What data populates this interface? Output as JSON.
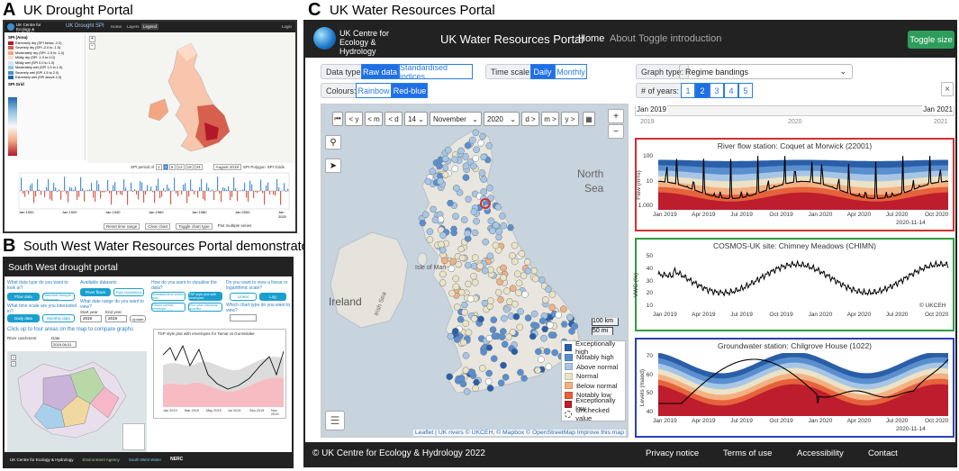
{
  "panels": {
    "a": {
      "letter": "A",
      "title": "UK Drought Portal"
    },
    "b": {
      "letter": "B",
      "title": "South West Water Resources Portal demonstrator"
    },
    "c": {
      "letter": "C",
      "title": "UK Water Resources Portal"
    }
  },
  "panel_a": {
    "logo_text": "UK Centre for Ecology & Hydrology",
    "portal_name": "UK Drought SPI",
    "nav": [
      "Home",
      "Layers",
      "Legend"
    ],
    "login": "Login",
    "legend_title": "SPI (Area)",
    "legend_items": [
      {
        "label": "Extremely dry (SPI below -2.0)",
        "color": "#b2182b"
      },
      {
        "label": "Severely dry (SPI -2.0 to -1.5)",
        "color": "#d6604d"
      },
      {
        "label": "Moderately dry (SPI -1.5 to -1.0)",
        "color": "#f4a582"
      },
      {
        "label": "Mildly dry (SPI -1.0 to 0.0)",
        "color": "#fddbc7"
      },
      {
        "label": "Mildly wet (SPI 0.0 to 1.0)",
        "color": "#d1e5f0"
      },
      {
        "label": "Moderately wet (SPI 1.0 to 1.5)",
        "color": "#92c5de"
      },
      {
        "label": "Severely wet (SPI 1.5 to 2.0)",
        "color": "#4393c3"
      },
      {
        "label": "Extremely wet (SPI above 2.0)",
        "color": "#2166ac"
      }
    ],
    "grid_legend_title": "SPI Grid",
    "controls_text": "SPI period of",
    "months": [
      "1",
      "3",
      "6",
      "12",
      "18",
      "24"
    ],
    "month_label": "August 2019",
    "spi_toggle": [
      "SPI Polygon",
      "SPI Grids"
    ],
    "x_years": [
      "Jan 1900",
      "Jan 1920",
      "Jan 1940",
      "Jan 1960",
      "Jan 1980",
      "Jan 2000",
      "Jan 2020"
    ],
    "bottom_controls": [
      "Reset time range",
      "Clear chart",
      "Toggle chart type",
      "Plot multiple series"
    ]
  },
  "panel_b": {
    "header": "South West drought portal",
    "questions": [
      "What data type do you want to look at?",
      "Available datasets",
      "How do you want to visualise the data?",
      "Do you want to view a linear or logarithmic scale?",
      "What time scale are you interested in?",
      "What date range do you want to view?",
      "Which chart type do you want to view?"
    ],
    "buttons": {
      "flow_data": "Flow data",
      "standard_indicators": "Standard drought indicators",
      "daily_data": "Daily data",
      "monthly_data": "Monthly data",
      "river_flows": "River flows",
      "rain": "Rain (Modelled)",
      "standard_time_series": "Standard time series plot",
      "tsp_style": "TSP style plot with envelopes",
      "five_year": "Five year historical quantile",
      "return_period": "Return period envelope",
      "linear": "Linear",
      "log": "Log",
      "update": "Update"
    },
    "start_label": "Start year",
    "end_label": "End year",
    "start_year": "2019",
    "end_year": "2019",
    "map_hint": "Click up to four areas on the map to compare graphs",
    "river_catchment": "River catchment",
    "date_label": "Date",
    "date_value": "2019-08-01",
    "chart_title": "TSP style plot with envelopes for Tamar at Gunnislake",
    "chart_x": [
      "Jan 2019",
      "Mar 2019",
      "May 2019",
      "Jul 2019",
      "Sep 2019",
      "Nov 2019"
    ],
    "footer_logos": [
      "UK Centre for Ecology & Hydrology",
      "Environment Agency",
      "South West Water",
      "NERC"
    ]
  },
  "panel_c": {
    "brand": "UK Centre for Ecology & Hydrology",
    "title": "UK Water Resources Portal",
    "nav": {
      "home": "Home",
      "about": "About",
      "intro": "Toggle introduction"
    },
    "toggle_size": "Toggle size",
    "data_type_label": "Data type:",
    "data_type_options": [
      "Raw data",
      "Standardised indices"
    ],
    "time_scale_label": "Time scale:",
    "time_scale_options": [
      "Daily",
      "Monthly"
    ],
    "colours_label": "Colours:",
    "colour_options": [
      "Rainbow",
      "Red-blue"
    ],
    "graph_type_label": "Graph type:",
    "graph_type_value": "Regime bandings",
    "years_label": "# of years:",
    "years_options": [
      "1",
      "2",
      "3",
      "4",
      "5"
    ],
    "years_selected": "2",
    "close": "×",
    "slider": {
      "start": "Jan 2019",
      "end": "Jan 2021",
      "ticks": [
        "2019",
        "2020",
        "2021"
      ]
    },
    "map_controls": {
      "back_y": "< y",
      "back_m": "< m",
      "back_d": "< d",
      "day": "14",
      "month": "November",
      "year": "2020",
      "fwd_d": "d >",
      "fwd_m": "m >",
      "fwd_y": "y >",
      "zoom_in": "+",
      "zoom_out": "−"
    },
    "map_labels": [
      {
        "text": "North",
        "big": true
      },
      {
        "text": "Sea",
        "big": true
      },
      {
        "text": "Ireland",
        "big": true
      },
      {
        "text": "Isle of Man",
        "big": false
      },
      {
        "text": "Irish Sea",
        "big": false
      }
    ],
    "scale": [
      "100 km",
      "50 mi"
    ],
    "legend": [
      {
        "label": "Exceptionally high",
        "color": "#2a5fa8"
      },
      {
        "label": "Notably high",
        "color": "#5a8fcf"
      },
      {
        "label": "Above normal",
        "color": "#a7c6e6"
      },
      {
        "label": "Normal",
        "color": "#ece3c6"
      },
      {
        "label": "Below normal",
        "color": "#f3b183"
      },
      {
        "label": "Notably low",
        "color": "#e5623b"
      },
      {
        "label": "Exceptionally low",
        "color": "#bd1d2d"
      },
      {
        "label": "Unchecked value",
        "color": "#ffffff"
      }
    ],
    "attribution": "Leaflet | UK rivers © UKCEH, © Mapbox © OpenStreetMap Improve this map",
    "charts": [
      {
        "title": "River flow station: Coquet at Morwick (22001)",
        "ylabel": "Flow (m³/s)",
        "yticks": [
          "100",
          "10",
          "1.000"
        ],
        "xticks": [
          "Jan 2019",
          "Apr 2019",
          "Jul 2019",
          "Oct 2019",
          "Jan 2020",
          "Apr 2020",
          "Jul 2020",
          "Oct 2020"
        ],
        "marker": "2020-11-14",
        "border": "#d32f2f"
      },
      {
        "title": "COSMOS-UK site: Chimney Meadows (CHIMN)",
        "ylabel": "VWC (%)",
        "yticks": [
          "50",
          "40",
          "30",
          "20",
          "10"
        ],
        "xticks": [
          "Jan 2019",
          "Apr 2019",
          "Jul 2019",
          "Oct 2019",
          "Jan 2020",
          "Apr 2020",
          "Jul 2020",
          "Oct 2020"
        ],
        "watermark": "© UKCEH",
        "border": "#2e9d3e"
      },
      {
        "title": "Groundwater station: Chilgrove House (1022)",
        "ylabel": "Levels (maod)",
        "yticks": [
          "70",
          "60",
          "50",
          "40"
        ],
        "xticks": [
          "Jan 2019",
          "Apr 2019",
          "Jul 2019",
          "Oct 2019",
          "Jan 2020",
          "Apr 2020",
          "Jul 2020",
          "Oct 2020"
        ],
        "marker": "2020-11-14",
        "border": "#2b3fbf"
      }
    ],
    "footer": {
      "copyright": "© UK Centre for Ecology & Hydrology 2022",
      "links": [
        "Privacy notice",
        "Terms of use",
        "Accessibility",
        "Contact"
      ]
    }
  }
}
